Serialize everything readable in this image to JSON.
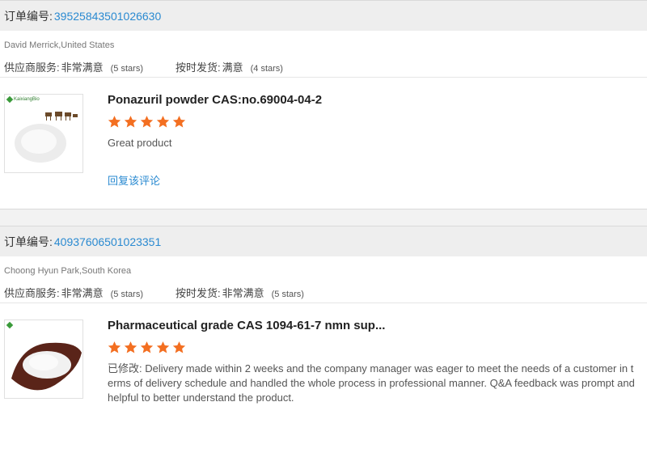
{
  "labels": {
    "order_number": "订单编号:",
    "supplier_service": "供应商服务:",
    "on_time_delivery": "按时发货:",
    "reply_review": "回复该评论"
  },
  "colors": {
    "star": "#f36f21",
    "link": "#2a8ad1"
  },
  "orders": [
    {
      "order_number": "39525843501026630",
      "buyer": "David Merrick,United States",
      "supplier_service": {
        "value": "非常满意",
        "stars": "(5 stars)"
      },
      "on_time_delivery": {
        "value": "满意",
        "stars": "(4 stars)"
      },
      "product_title": "Ponazuril powder CAS:no.69004-04-2",
      "product_image_logo": "KaixiangBio",
      "rating": 5,
      "review_text": "Great product",
      "reply_label": "回复该评论"
    },
    {
      "order_number": "40937606501023351",
      "buyer": "Choong Hyun Park,South Korea",
      "supplier_service": {
        "value": "非常满意",
        "stars": "(5 stars)"
      },
      "on_time_delivery": {
        "value": "非常满意",
        "stars": "(5 stars)"
      },
      "product_title": "Pharmaceutical grade CAS 1094-61-7 nmn sup...",
      "rating": 5,
      "review_text": "已修改: Delivery made within 2 weeks and the company manager was eager to meet the needs of a customer in terms of delivery schedule and handled the whole process in professional manner. Q&A feedback was prompt and helpful to better understand the product."
    }
  ]
}
